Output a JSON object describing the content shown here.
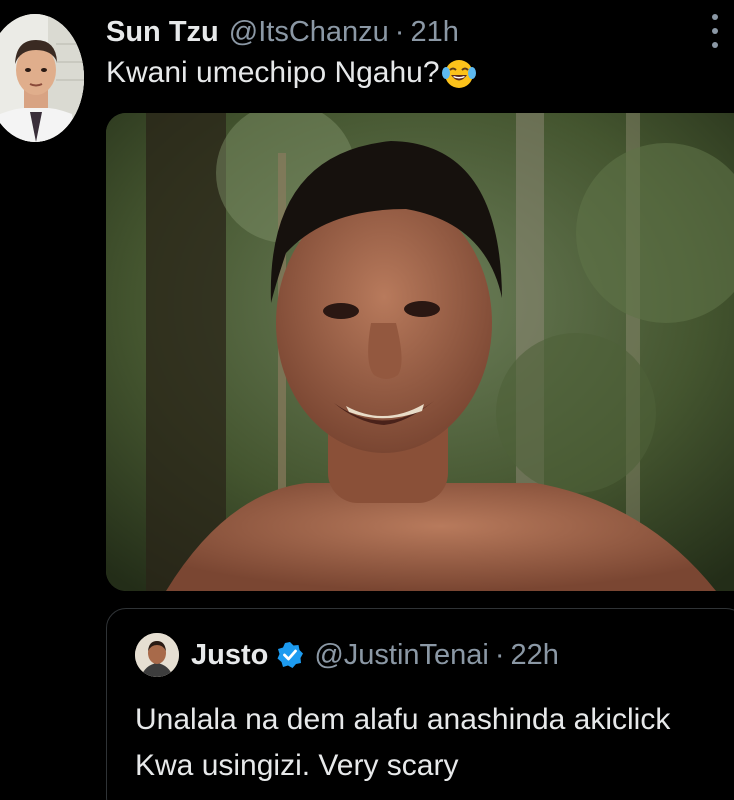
{
  "tweet": {
    "display_name": "Sun Tzu",
    "handle": "@ItsChanzu",
    "separator": "·",
    "time": "21h",
    "text": "Kwani umechipo Ngahu?",
    "emoji": "face-with-tears-of-joy",
    "media": {
      "description_icon": "photo"
    }
  },
  "quoted_tweet": {
    "display_name": "Justo",
    "verified": true,
    "handle": "@JustinTenai",
    "separator": "·",
    "time": "22h",
    "text": "Unalala na dem alafu anashinda akiclick Kwa usingizi. Very scary"
  },
  "colors": {
    "background": "#000000",
    "text_primary": "#e7e9ea",
    "text_secondary": "#8b98a5",
    "border": "#2f3336",
    "verified": "#1d9bf0"
  }
}
